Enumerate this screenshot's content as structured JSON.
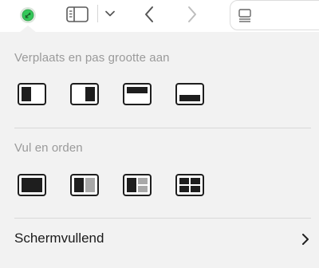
{
  "toolbar": {
    "icons": [
      "green-window-dot",
      "sidebar-icon",
      "chevron-down-icon",
      "back-arrow-icon",
      "forward-arrow-icon",
      "tab-overview-icon"
    ],
    "colors": {
      "green": "#35c759",
      "icon": "#555555",
      "disabled": "#bdbdbd"
    }
  },
  "menu": {
    "section_move_resize": "Verplaats en pas grootte aan",
    "move_resize_tiles": [
      "left-half-icon",
      "right-half-icon",
      "top-half-icon",
      "bottom-half-icon"
    ],
    "section_fill_arrange": "Vul en orden",
    "fill_arrange_tiles": [
      "fill-icon",
      "left-right-split-icon",
      "left-and-quarters-icon",
      "four-quarters-icon"
    ],
    "fullscreen_label": "Schermvullend"
  }
}
